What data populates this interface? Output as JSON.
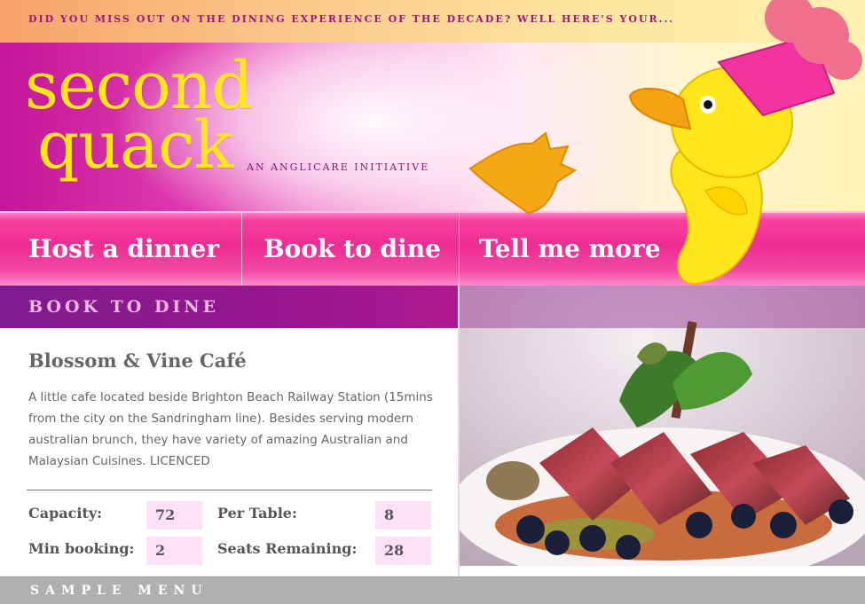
{
  "header": {
    "tagline": "DID YOU MISS OUT ON THE DINING EXPERIENCE OF THE DECADE? WELL HERE'S YOUR...",
    "logo_line1": "second",
    "logo_line2": "quack",
    "initiative": "AN ANGLICARE INITIATIVE",
    "mascot_icon": "duck-chef-icon"
  },
  "nav": {
    "items": [
      {
        "label": "Host a dinner"
      },
      {
        "label": "Book to dine"
      },
      {
        "label": "Tell me more"
      }
    ]
  },
  "section": {
    "title": "BOOK TO DINE"
  },
  "venue": {
    "name": "Blossom & Vine Café",
    "description": "A little cafe located beside Brighton Beach Railway Station (15mins from the city on the Sandringham line). Besides serving modern australian brunch, they have variety of amazing Australian and Malaysian Cuisines. LICENCED",
    "stats": {
      "capacity_label": "Capacity:",
      "capacity_value": "72",
      "per_table_label": "Per Table:",
      "per_table_value": "8",
      "min_booking_label": "Min booking:",
      "min_booking_value": "2",
      "seats_remaining_label": "Seats Remaining:",
      "seats_remaining_value": "28"
    }
  },
  "footer": {
    "title": "SAMPLE MENU"
  },
  "colors": {
    "brand_pink": "#ee2c93",
    "brand_purple": "#7e1b8e",
    "logo_yellow": "#ffe81a",
    "value_bg": "#ffe0f7"
  }
}
